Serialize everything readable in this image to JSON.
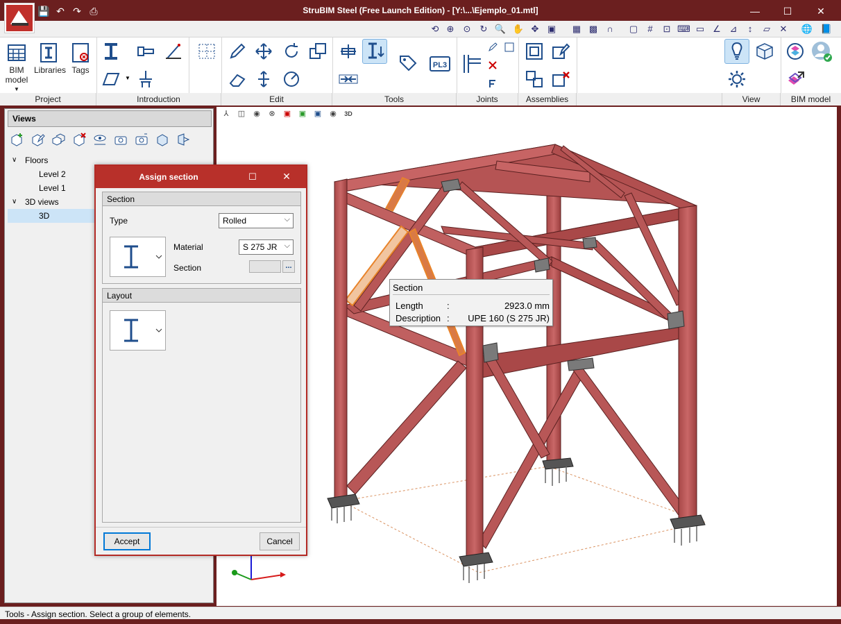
{
  "window": {
    "title": "StruBIM Steel (Free Launch Edition) - [Y:\\...\\Ejemplo_01.mtl]",
    "minimize": "—",
    "maximize": "☐",
    "close": "✕"
  },
  "ribbon": {
    "project": {
      "label": "Project",
      "bim_model_line1": "BIM",
      "bim_model_line2": "model",
      "libraries": "Libraries",
      "tags": "Tags"
    },
    "introduction": {
      "label": "Introduction"
    },
    "edit": {
      "label": "Edit"
    },
    "tools": {
      "label": "Tools",
      "plate_label": "PL3"
    },
    "joints": {
      "label": "Joints"
    },
    "assemblies": {
      "label": "Assemblies"
    },
    "view": {
      "label": "View"
    },
    "bim_model": {
      "label": "BIM model"
    }
  },
  "views_panel": {
    "header": "Views",
    "tree": [
      {
        "label": "Floors",
        "level": 0,
        "expander": "∨"
      },
      {
        "label": "Level 2",
        "level": 2
      },
      {
        "label": "Level 1",
        "level": 2
      },
      {
        "label": "3D views",
        "level": 0,
        "expander": "∨"
      },
      {
        "label": "3D",
        "level": 2,
        "selected": true
      }
    ]
  },
  "viewport": {
    "view3d_badge": "3D"
  },
  "tooltip": {
    "title": "Section",
    "rows": [
      {
        "key": "Length",
        "sep": ":",
        "value": "2923.0 mm"
      },
      {
        "key": "Description",
        "sep": ":",
        "value": "UPE 160 (S 275 JR)"
      }
    ]
  },
  "dialog": {
    "title": "Assign section",
    "section_group": "Section",
    "type_label": "Type",
    "type_value": "Rolled",
    "material_label": "Material",
    "material_value": "S 275 JR",
    "section_label": "Section",
    "section_value": "",
    "browse_label": "...",
    "layout_group": "Layout",
    "accept": "Accept",
    "cancel": "Cancel"
  },
  "status_bar": {
    "text": "Tools - Assign section. Select a group of elements."
  },
  "colors": {
    "frame": "#6b1f1f",
    "dialog_title": "#b8302a",
    "steel": "#c25b5b",
    "selection": "#e8832a",
    "accent_icon": "#1f4e8c"
  }
}
